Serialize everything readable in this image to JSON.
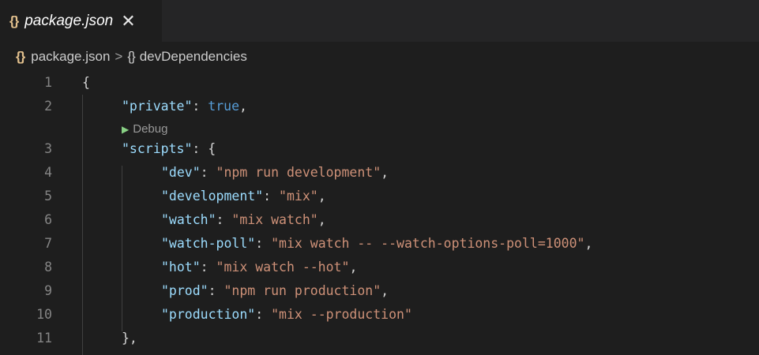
{
  "tab": {
    "icon": "{}",
    "title": "package.json",
    "close": "✕"
  },
  "breadcrumb": {
    "icon": "{}",
    "file": "package.json",
    "separator": ">",
    "icon2": "{}",
    "symbol": "devDependencies"
  },
  "codelens": {
    "label": "Debug"
  },
  "lines": [
    {
      "n": "1",
      "parts": [
        {
          "t": "{",
          "c": "punc"
        }
      ]
    },
    {
      "n": "2",
      "parts": [
        {
          "t": "\"private\"",
          "c": "key"
        },
        {
          "t": ": ",
          "c": "punc"
        },
        {
          "t": "true",
          "c": "kw"
        },
        {
          "t": ",",
          "c": "punc"
        }
      ]
    },
    {
      "n": "3",
      "parts": [
        {
          "t": "\"scripts\"",
          "c": "key"
        },
        {
          "t": ": {",
          "c": "punc"
        }
      ]
    },
    {
      "n": "4",
      "parts": [
        {
          "t": "\"dev\"",
          "c": "key"
        },
        {
          "t": ": ",
          "c": "punc"
        },
        {
          "t": "\"npm run development\"",
          "c": "str"
        },
        {
          "t": ",",
          "c": "punc"
        }
      ]
    },
    {
      "n": "5",
      "parts": [
        {
          "t": "\"development\"",
          "c": "key"
        },
        {
          "t": ": ",
          "c": "punc"
        },
        {
          "t": "\"mix\"",
          "c": "str"
        },
        {
          "t": ",",
          "c": "punc"
        }
      ]
    },
    {
      "n": "6",
      "parts": [
        {
          "t": "\"watch\"",
          "c": "key"
        },
        {
          "t": ": ",
          "c": "punc"
        },
        {
          "t": "\"mix watch\"",
          "c": "str"
        },
        {
          "t": ",",
          "c": "punc"
        }
      ]
    },
    {
      "n": "7",
      "parts": [
        {
          "t": "\"watch-poll\"",
          "c": "key"
        },
        {
          "t": ": ",
          "c": "punc"
        },
        {
          "t": "\"mix watch -- --watch-options-poll=1000\"",
          "c": "str"
        },
        {
          "t": ",",
          "c": "punc"
        }
      ]
    },
    {
      "n": "8",
      "parts": [
        {
          "t": "\"hot\"",
          "c": "key"
        },
        {
          "t": ": ",
          "c": "punc"
        },
        {
          "t": "\"mix watch --hot\"",
          "c": "str"
        },
        {
          "t": ",",
          "c": "punc"
        }
      ]
    },
    {
      "n": "9",
      "parts": [
        {
          "t": "\"prod\"",
          "c": "key"
        },
        {
          "t": ": ",
          "c": "punc"
        },
        {
          "t": "\"npm run production\"",
          "c": "str"
        },
        {
          "t": ",",
          "c": "punc"
        }
      ]
    },
    {
      "n": "10",
      "parts": [
        {
          "t": "\"production\"",
          "c": "key"
        },
        {
          "t": ": ",
          "c": "punc"
        },
        {
          "t": "\"mix --production\"",
          "c": "str"
        }
      ]
    },
    {
      "n": "11",
      "parts": [
        {
          "t": "},",
          "c": "punc"
        }
      ]
    }
  ],
  "colors": {
    "background": "#1e1e1e",
    "tabbar": "#252526",
    "key": "#9cdcfe",
    "string": "#ce9178",
    "keyword": "#569cd6",
    "json_icon": "#e2c08d"
  }
}
